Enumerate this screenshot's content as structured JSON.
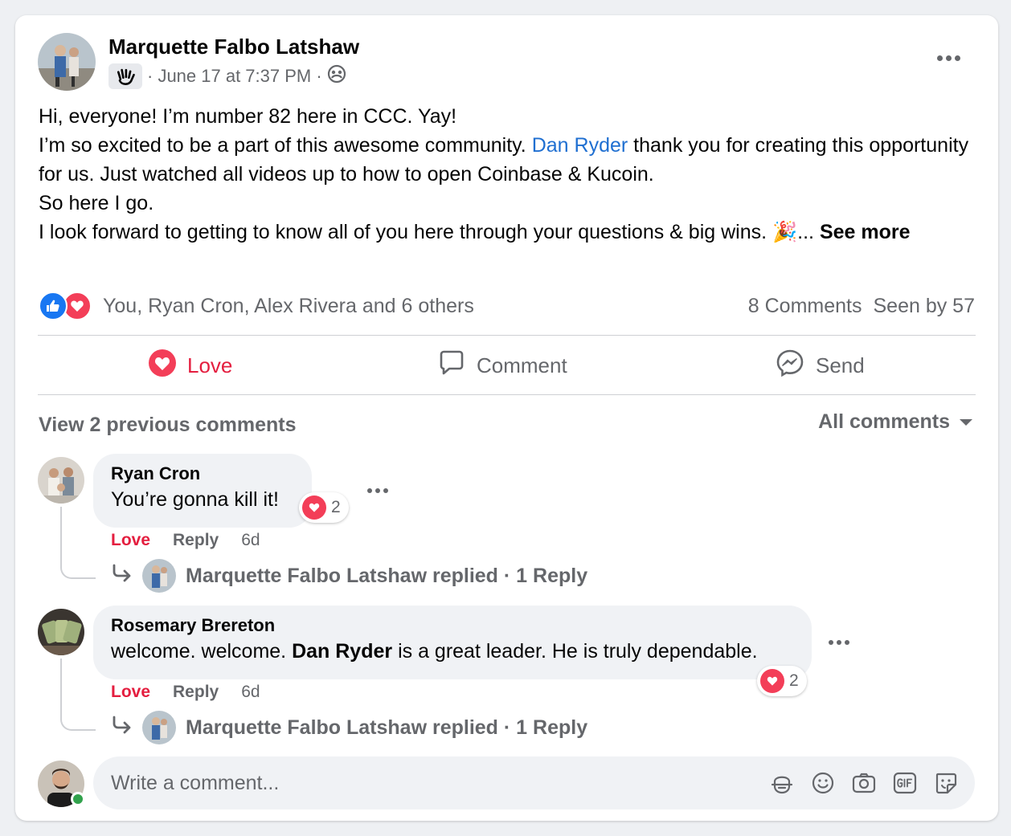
{
  "post": {
    "author": "Marquette Falbo Latshaw",
    "meta": "· June 17 at 7:37 PM ·",
    "lines": [
      "Hi, everyone! I’m number 82 here in CCC. Yay!",
      "I’m so excited to be a part of this awesome community.",
      "Dan Ryder",
      "thank you for creating this opportunity for us. Just watched all videos up to how to open Coinbase & Kucoin.",
      "So here I go.",
      "I look forward to getting to know all of you here through your questions & big wins. 🎉...",
      "See more"
    ],
    "reactions_text": "You, Ryan Cron, Alex Rivera and 6 others",
    "comments_count": "8 Comments",
    "seen_by": "Seen by 57"
  },
  "actions": {
    "love": "Love",
    "comment": "Comment",
    "send": "Send"
  },
  "comments_header": {
    "view_previous": "View 2 previous comments",
    "filter": "All comments"
  },
  "comments": [
    {
      "name": "Ryan Cron",
      "text": "You’re gonna kill it!",
      "reaction_count": "2",
      "love": "Love",
      "reply": "Reply",
      "time": "6d",
      "replied": "Marquette Falbo Latshaw replied · 1 Reply"
    },
    {
      "name": "Rosemary Brereton",
      "text_pre": "welcome. welcome. ",
      "mention": "Dan Ryder",
      "text_post": " is a great leader. He is truly dependable.",
      "reaction_count": "2",
      "love": "Love",
      "reply": "Reply",
      "time": "6d",
      "replied": "Marquette Falbo Latshaw replied · 1 Reply"
    }
  ],
  "composer": {
    "placeholder": "Write a comment..."
  },
  "colors": {
    "accent_blue": "#1877f2",
    "love_red": "#e41e3f",
    "muted": "#65676b",
    "bubble": "#f0f2f5"
  }
}
